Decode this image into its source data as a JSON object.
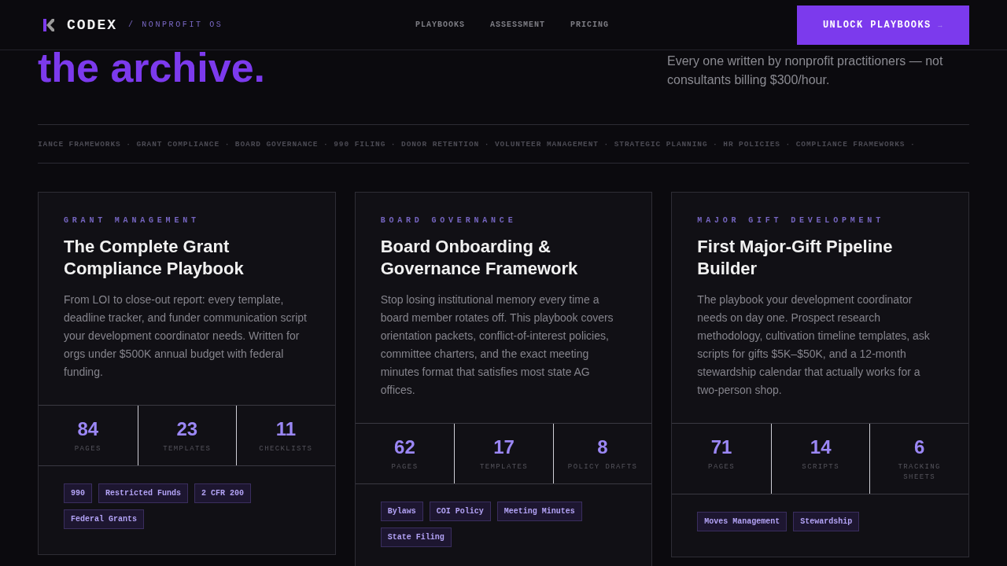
{
  "header": {
    "brand": "CODEX",
    "tagline": "/ NONPROFIT OS",
    "nav": [
      "PLAYBOOKS",
      "ASSESSMENT",
      "PRICING"
    ],
    "cta": {
      "label": "UNLOCK PLAYBOOKS",
      "arrow": "→"
    }
  },
  "hero": {
    "headline": "the archive.",
    "lede": "Every one written by nonprofit practitioners — not consultants billing $300/hour."
  },
  "ticker": "IANCE FRAMEWORKS · GRANT COMPLIANCE · BOARD GOVERNANCE · 990 FILING · DONOR RETENTION · VOLUNTEER MANAGEMENT · STRATEGIC PLANNING · HR POLICIES · COMPLIANCE FRAMEWORKS ·",
  "cards": [
    {
      "category": "GRANT MANAGEMENT",
      "title": "The Complete Grant Compliance Playbook",
      "description": "From LOI to close-out report: every template, deadline tracker, and funder communication script your development coordinator needs. Written for orgs under $500K annual budget with federal funding.",
      "stats": [
        {
          "value": "84",
          "label": "PAGES"
        },
        {
          "value": "23",
          "label": "TEMPLATES"
        },
        {
          "value": "11",
          "label": "CHECKLISTS"
        }
      ],
      "tags": [
        "990",
        "Restricted Funds",
        "2 CFR 200",
        "Federal Grants"
      ]
    },
    {
      "category": "BOARD GOVERNANCE",
      "title": "Board Onboarding & Governance Framework",
      "description": "Stop losing institutional memory every time a board member rotates off. This playbook covers orientation packets, conflict-of-interest policies, committee charters, and the exact meeting minutes format that satisfies most state AG offices.",
      "stats": [
        {
          "value": "62",
          "label": "PAGES"
        },
        {
          "value": "17",
          "label": "TEMPLATES"
        },
        {
          "value": "8",
          "label": "POLICY DRAFTS"
        }
      ],
      "tags": [
        "Bylaws",
        "COI Policy",
        "Meeting Minutes",
        "State Filing"
      ]
    },
    {
      "category": "MAJOR GIFT DEVELOPMENT",
      "title": "First Major-Gift Pipeline Builder",
      "description": "The playbook your development coordinator needs on day one. Prospect research methodology, cultivation timeline templates, ask scripts for gifts $5K–$50K, and a 12-month stewardship calendar that actually works for a two-person shop.",
      "stats": [
        {
          "value": "71",
          "label": "PAGES"
        },
        {
          "value": "14",
          "label": "SCRIPTS"
        },
        {
          "value": "6",
          "label": "TRACKING SHEETS"
        }
      ],
      "tags": [
        "Moves Management",
        "Stewardship"
      ]
    }
  ]
}
